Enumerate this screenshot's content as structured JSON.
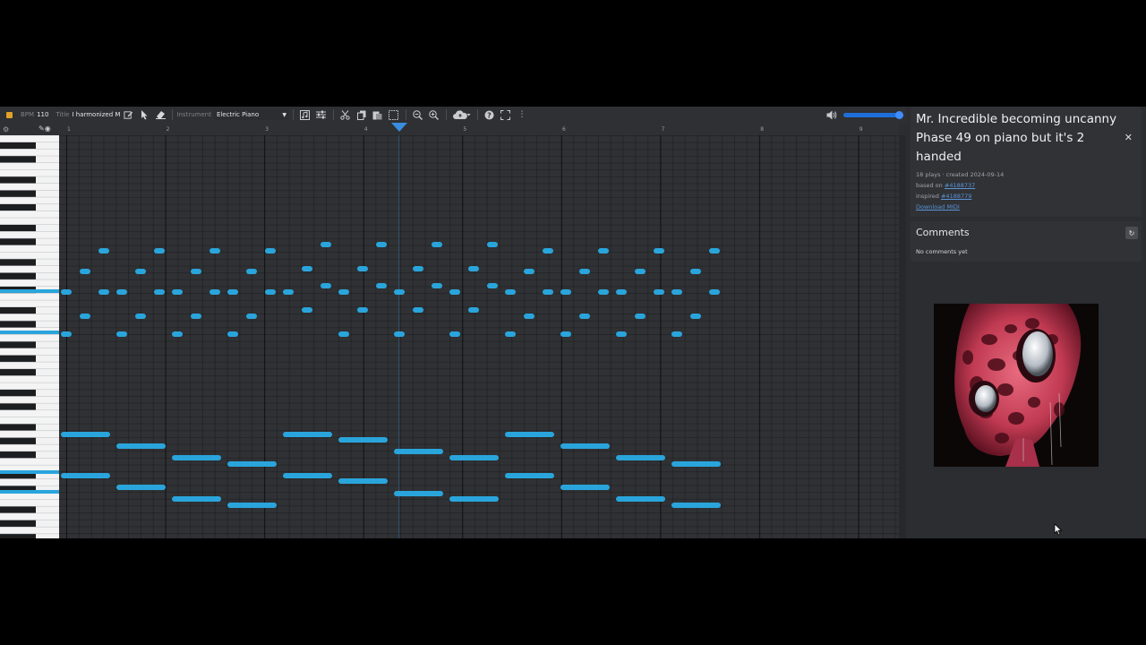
{
  "toolbar": {
    "bpm_label": "BPM",
    "bpm_value": "110",
    "title_label": "Title",
    "title_value": "I harmonized M",
    "instrument_label": "Instrument",
    "instrument_value": "Electric Piano"
  },
  "ruler": {
    "measures": [
      "1",
      "2",
      "3",
      "4",
      "5",
      "6",
      "7",
      "8",
      "9"
    ]
  },
  "song": {
    "title": "Mr. Incredible becoming uncanny Phase 49 on piano but it's 2 handed",
    "plays": "18 plays · created 2024-09-14",
    "based_on_label": "based on",
    "based_on_link": "#4188737",
    "inspired_label": "inspired",
    "inspired_link": "#4188779",
    "download": "Download MIDI"
  },
  "comments": {
    "title": "Comments",
    "empty": "No comments yet"
  },
  "colors": {
    "note": "#2aa5dc",
    "accent": "#1e6fd9",
    "grid_bg": "#2f3134"
  },
  "icons": {
    "edit": "pencil-icon",
    "select": "pointer-icon",
    "erase": "eraser-icon",
    "cut": "scissors-icon",
    "copy": "copy-icon",
    "paste": "paste-icon",
    "zoom_out": "zoom-out-icon",
    "zoom_in": "zoom-in-icon",
    "save": "cloud-upload-icon",
    "help": "help-icon",
    "fullscreen": "fullscreen-icon",
    "volume": "speaker-icon"
  },
  "volume_fraction": 1.0
}
